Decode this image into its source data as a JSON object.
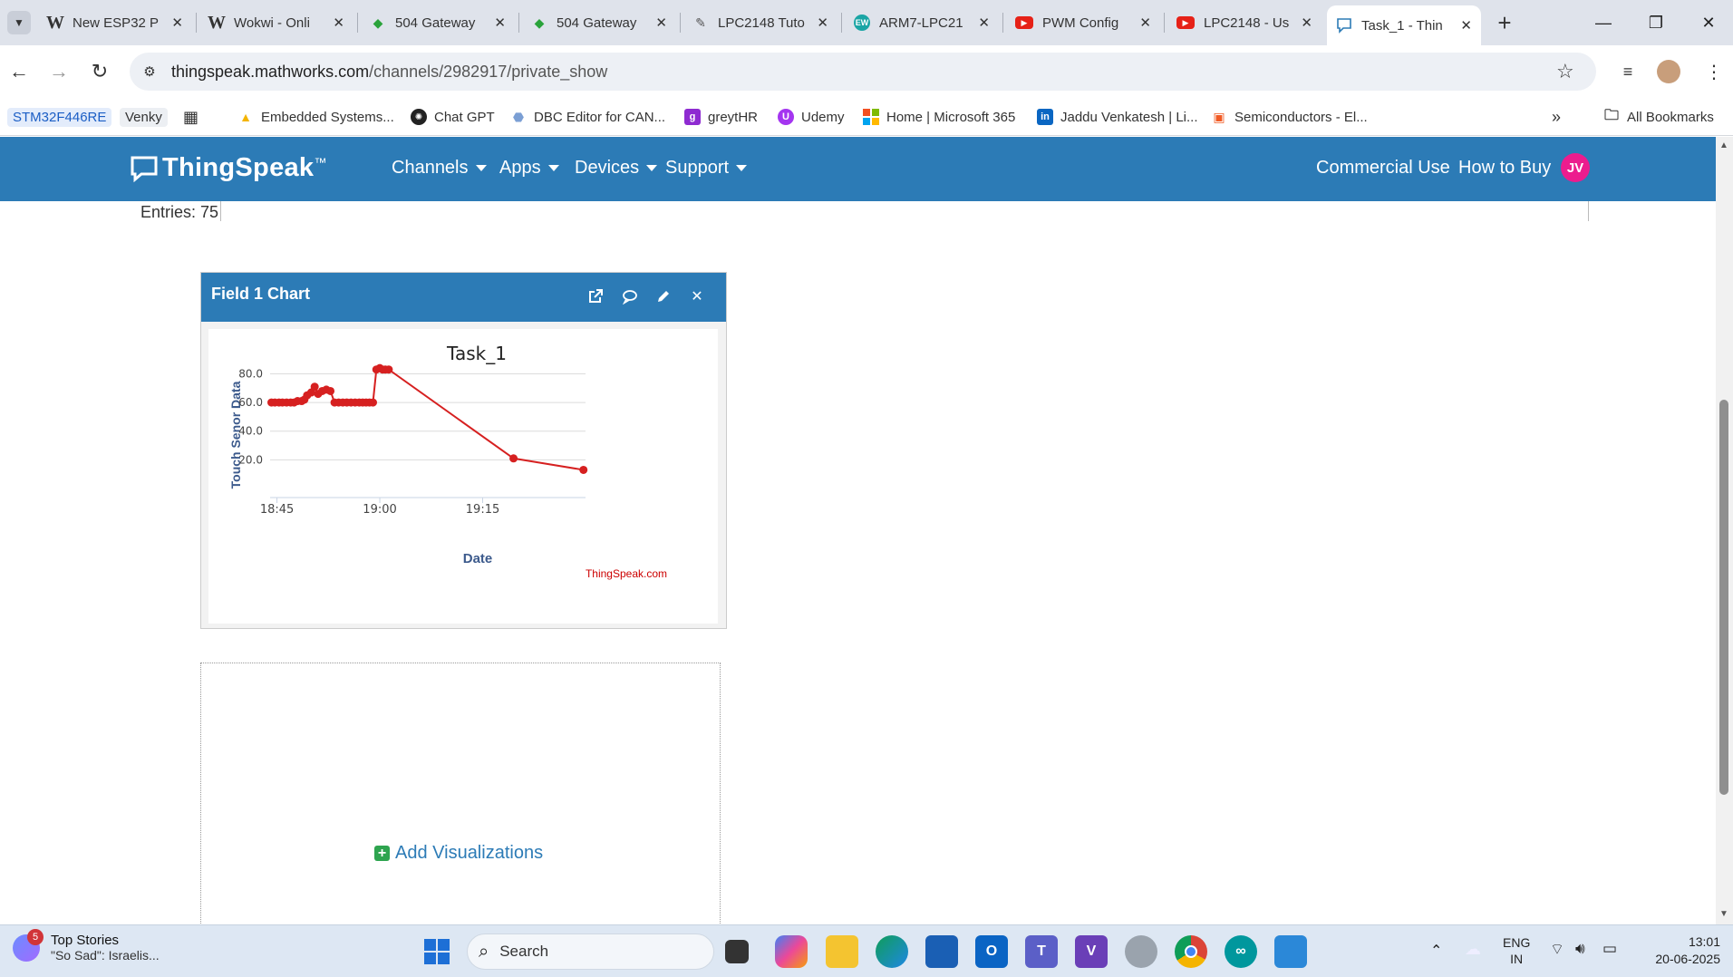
{
  "tabs": [
    {
      "title": "New ESP32 P",
      "favicon": "W"
    },
    {
      "title": "Wokwi - Onli",
      "favicon": "W"
    },
    {
      "title": "504 Gateway",
      "favicon": "◆"
    },
    {
      "title": "504 Gateway",
      "favicon": "◆"
    },
    {
      "title": "LPC2148 Tuto",
      "favicon": "✎"
    },
    {
      "title": "ARM7-LPC21",
      "favicon": "EW"
    },
    {
      "title": "PWM Config",
      "favicon": "▶"
    },
    {
      "title": "LPC2148 - Us",
      "favicon": "▶"
    },
    {
      "title": "Task_1 - Thin",
      "favicon": "💬"
    }
  ],
  "new_tab_label": "+",
  "address": {
    "domain": "thingspeak.mathworks.com",
    "path": "/channels/2982917/private_show"
  },
  "bookmarks": [
    {
      "label": "STM32F446RE"
    },
    {
      "label": "Venky"
    },
    {
      "label": "Embedded Systems..."
    },
    {
      "label": "Chat GPT"
    },
    {
      "label": "DBC Editor for CAN..."
    },
    {
      "label": "greytHR"
    },
    {
      "label": "Udemy"
    },
    {
      "label": "Home | Microsoft 365"
    },
    {
      "label": "Jaddu Venkatesh | Li..."
    },
    {
      "label": "Semiconductors - El..."
    }
  ],
  "all_bookmarks_label": "All Bookmarks",
  "header": {
    "brand": "ThingSpeak",
    "trademark": "™",
    "menus": [
      "Channels",
      "Apps",
      "Devices",
      "Support"
    ],
    "commercial_use": "Commercial Use",
    "how_to_buy": "How to Buy",
    "avatar_initials": "JV"
  },
  "channel": {
    "entries_label": "Entries: 75"
  },
  "field_chart": {
    "title": "Field 1 Chart"
  },
  "chart_data": {
    "type": "line",
    "title": "Task_1",
    "xlabel": "Date",
    "ylabel": "Touch Senor Data",
    "credit": "ThingSpeak.com",
    "ylim": [
      0,
      86
    ],
    "yticks": [
      20.0,
      40.0,
      60.0,
      80.0
    ],
    "ytick_labels": [
      "20.0",
      "40.0",
      "60.0",
      "80.0"
    ],
    "xlim_minutes": [
      -1,
      45
    ],
    "xticks_minutes": [
      0,
      15,
      30
    ],
    "xtick_labels": [
      "18:45",
      "19:00",
      "19:15"
    ],
    "x_times": [
      "18:44",
      "18:44",
      "18:45",
      "18:45",
      "18:46",
      "18:46",
      "18:47",
      "18:47",
      "18:48",
      "18:48",
      "18:48",
      "18:49",
      "18:49",
      "18:50",
      "18:50",
      "18:51",
      "18:51",
      "18:52",
      "18:52",
      "18:53",
      "18:53",
      "18:54",
      "18:54",
      "18:55",
      "18:55",
      "18:56",
      "18:56",
      "18:57",
      "18:57",
      "18:58",
      "18:58",
      "18:58",
      "18:59",
      "19:10",
      "19:20"
    ],
    "x": [
      -0.8,
      -0.3,
      0.3,
      0.8,
      1.4,
      2.0,
      2.5,
      3.0,
      3.6,
      4.0,
      4.4,
      5.0,
      5.5,
      6.0,
      6.6,
      7.2,
      7.8,
      8.4,
      9.0,
      9.6,
      10.2,
      10.8,
      11.4,
      12.0,
      12.5,
      13.0,
      13.5,
      14.0,
      14.5,
      15.0,
      15.4,
      15.8,
      16.3,
      34.5,
      44.7
    ],
    "values": [
      60,
      60,
      60,
      60,
      60,
      60,
      60,
      61,
      61,
      62,
      65,
      67,
      71,
      66,
      68,
      69,
      68,
      60,
      60,
      60,
      60,
      60,
      60,
      60,
      60,
      60,
      60,
      60,
      83,
      84,
      83,
      83,
      83,
      21,
      13,
      12
    ],
    "color": "#d62020"
  },
  "add_visualizations_label": "Add Visualizations",
  "taskbar": {
    "news_title": "Top Stories",
    "news_subtitle": "\"So Sad\": Israelis...",
    "news_badge": "5",
    "search_placeholder": "Search",
    "lang_line1": "ENG",
    "lang_line2": "IN",
    "time": "13:01",
    "date": "20-06-2025"
  }
}
